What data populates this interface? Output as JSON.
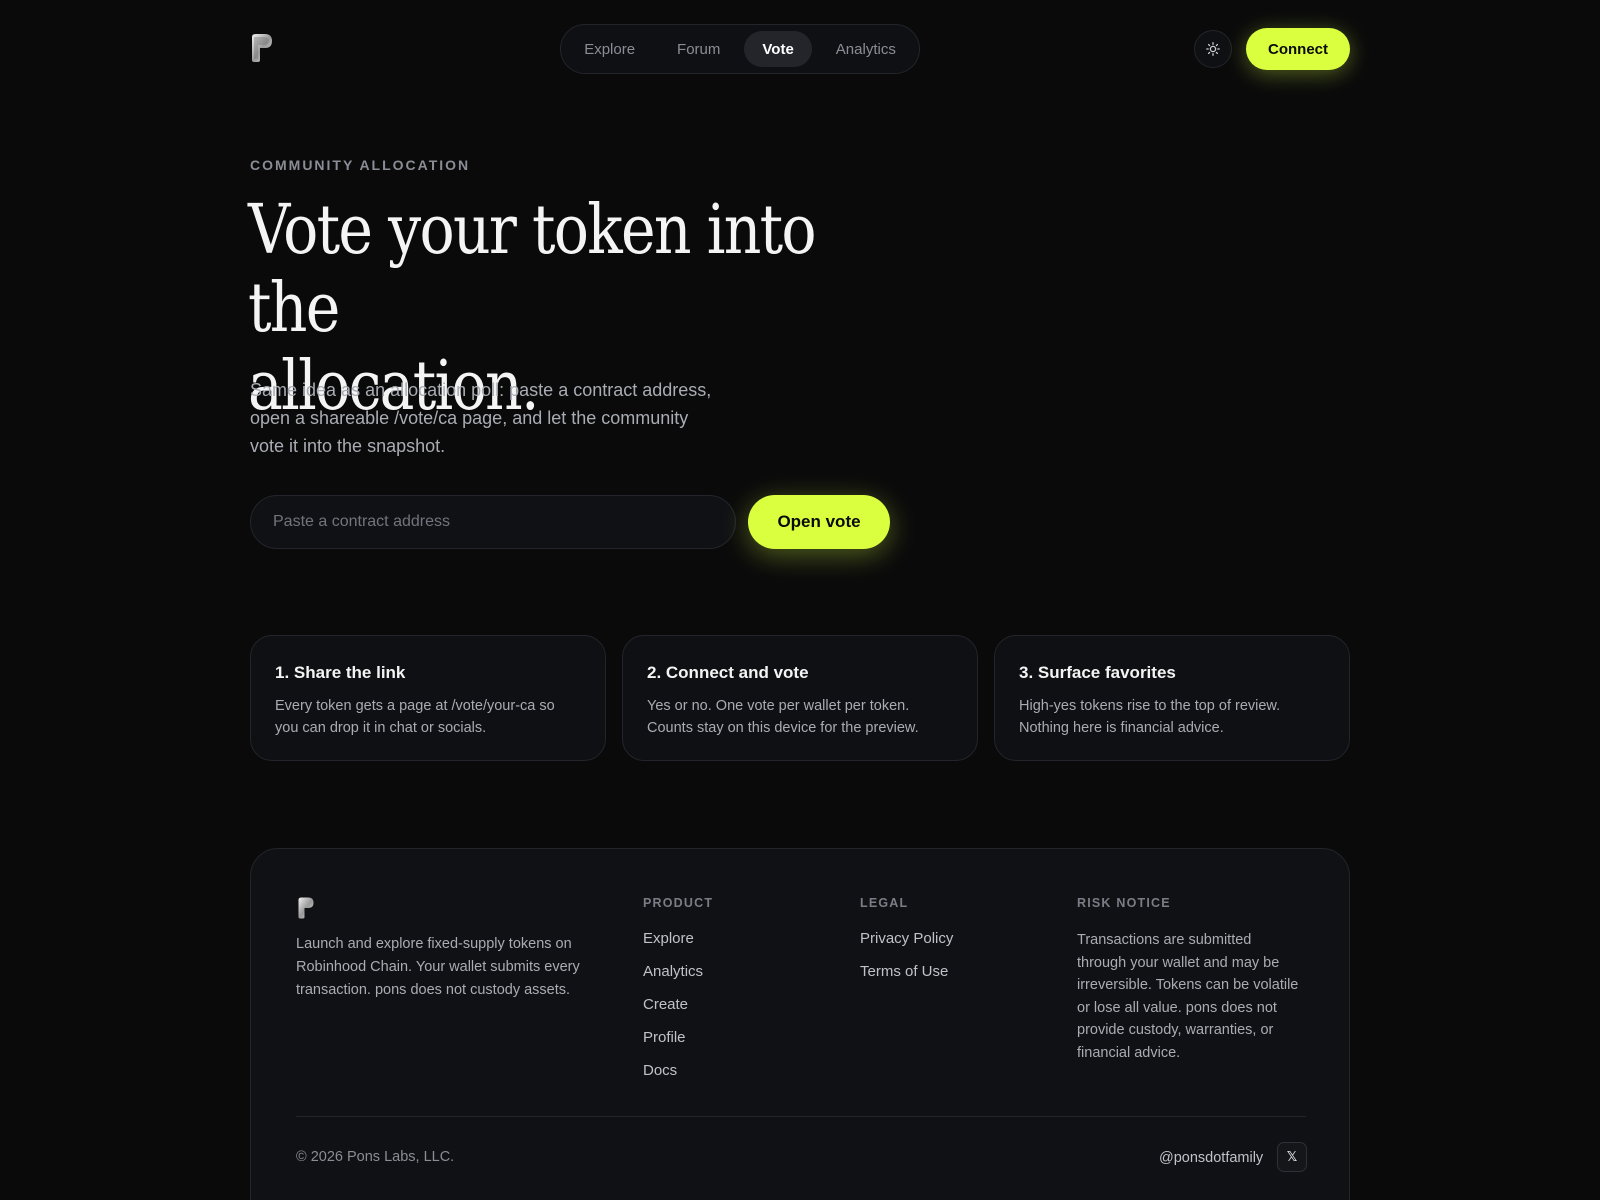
{
  "nav": {
    "items": [
      {
        "label": "Explore",
        "active": false
      },
      {
        "label": "Forum",
        "active": false
      },
      {
        "label": "Vote",
        "active": true
      },
      {
        "label": "Analytics",
        "active": false
      }
    ],
    "theme_icon": "sun-icon",
    "connect_label": "Connect"
  },
  "hero": {
    "eyebrow": "COMMUNITY ALLOCATION",
    "title_line1": "Vote your token into the",
    "title_line2": "allocation.",
    "description": "Same idea as an allocation poll: paste a contract address, open a shareable /vote/ca page, and let the community vote it into the snapshot.",
    "input_placeholder": "Paste a contract address",
    "button_label": "Open vote"
  },
  "steps": [
    {
      "title": "1. Share the link",
      "body": "Every token gets a page at /vote/your-ca so you can drop it in chat or socials."
    },
    {
      "title": "2. Connect and vote",
      "body": "Yes or no. One vote per wallet per token. Counts stay on this device for the preview."
    },
    {
      "title": "3. Surface favorites",
      "body": "High-yes tokens rise to the top of review. Nothing here is financial advice."
    }
  ],
  "footer": {
    "about": "Launch and explore fixed-supply tokens on Robinhood Chain. Your wallet submits every transaction. pons does not custody assets.",
    "product": {
      "heading": "PRODUCT",
      "links": [
        "Explore",
        "Analytics",
        "Create",
        "Profile",
        "Docs"
      ]
    },
    "legal": {
      "heading": "LEGAL",
      "links": [
        "Privacy Policy",
        "Terms of Use"
      ]
    },
    "risk": {
      "heading": "RISK NOTICE",
      "text": "Transactions are submitted through your wallet and may be irreversible. Tokens can be volatile or lose all value. pons does not provide custody, warranties, or financial advice."
    },
    "copyright": "© 2026 Pons Labs, LLC.",
    "handle": "@ponsdotfamily",
    "x_label": "𝕏"
  },
  "colors": {
    "background": "#0a0a0b",
    "accent": "#d9ff3f",
    "border": "#23252b",
    "card": "#0f1013"
  }
}
